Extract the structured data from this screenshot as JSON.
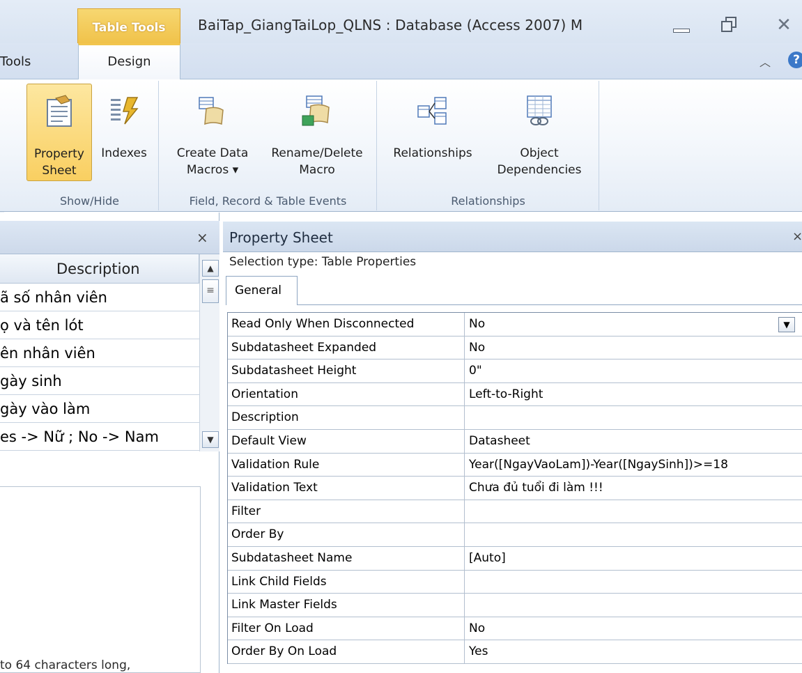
{
  "titlebar": {
    "context_tab_group": "Table Tools",
    "window_title": "BaiTap_GiangTaiLop_QLNS : Database (Access 2007) M"
  },
  "tabs": {
    "tools": "Tools",
    "design": "Design"
  },
  "ribbon": {
    "groups": [
      {
        "label": "Show/Hide",
        "buttons": [
          {
            "label_line1": "Property",
            "label_line2": "Sheet",
            "icon": "property-sheet-icon",
            "active": true
          },
          {
            "label_line1": "Indexes",
            "label_line2": "",
            "icon": "indexes-icon",
            "active": false
          }
        ]
      },
      {
        "label": "Field, Record & Table Events",
        "buttons": [
          {
            "label_line1": "Create Data",
            "label_line2": "Macros ▾",
            "icon": "create-data-macros-icon"
          },
          {
            "label_line1": "Rename/Delete",
            "label_line2": "Macro",
            "icon": "rename-delete-macro-icon"
          }
        ]
      },
      {
        "label": "Relationships",
        "buttons": [
          {
            "label_line1": "Relationships",
            "label_line2": "",
            "icon": "relationships-icon"
          },
          {
            "label_line1": "Object",
            "label_line2": "Dependencies",
            "icon": "object-dependencies-icon"
          }
        ]
      }
    ]
  },
  "field_pane": {
    "close": "×",
    "column_header": "Description",
    "rows": [
      "ã số nhân viên",
      "ọ và tên lót",
      "ên nhân viên",
      "gày sinh",
      "gày vào làm",
      "es -> Nữ ; No -> Nam"
    ],
    "help_text": "to 64 characters long,"
  },
  "property_sheet": {
    "title": "Property Sheet",
    "close": "×",
    "selection_type": "Selection type:  Table Properties",
    "tab": "General",
    "properties": [
      {
        "name": "Read Only When Disconnected",
        "value": "No",
        "dropdown": true
      },
      {
        "name": "Subdatasheet Expanded",
        "value": "No"
      },
      {
        "name": "Subdatasheet Height",
        "value": "0\""
      },
      {
        "name": "Orientation",
        "value": "Left-to-Right"
      },
      {
        "name": "Description",
        "value": ""
      },
      {
        "name": "Default View",
        "value": "Datasheet"
      },
      {
        "name": "Validation Rule",
        "value": "Year([NgayVaoLam])-Year([NgaySinh])>=18"
      },
      {
        "name": "Validation Text",
        "value": "Chưa đủ tuổi đi làm !!!"
      },
      {
        "name": "Filter",
        "value": ""
      },
      {
        "name": "Order By",
        "value": ""
      },
      {
        "name": "Subdatasheet Name",
        "value": "[Auto]"
      },
      {
        "name": "Link Child Fields",
        "value": ""
      },
      {
        "name": "Link Master Fields",
        "value": ""
      },
      {
        "name": "Filter On Load",
        "value": "No"
      },
      {
        "name": "Order By On Load",
        "value": "Yes"
      }
    ]
  },
  "colors": {
    "accent_gold": "#f2c54e",
    "ribbon_blue": "#dbe5f3"
  }
}
